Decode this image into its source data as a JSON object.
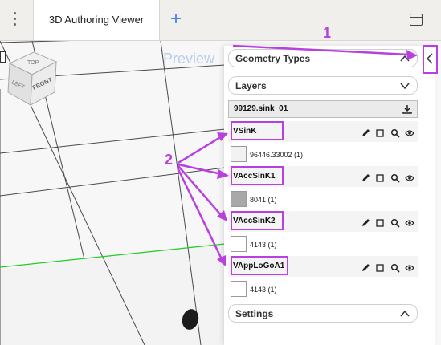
{
  "tabbar": {
    "tab_title": "3D Authoring Viewer",
    "plus": "+"
  },
  "viewport": {
    "preview_label": "Preview",
    "cube": {
      "top": "TOP",
      "left": "LEFT",
      "front": "FRONT"
    }
  },
  "panel": {
    "geometry_types": "Geometry Types",
    "layers": "Layers",
    "file_name": "99129.sink_01",
    "items": [
      {
        "name": "VSinK",
        "material": "96446.33002 (1)",
        "swatch_color": "#f2f2f2"
      },
      {
        "name": "VAccSinK1",
        "material": "8041 (1)",
        "swatch_color": "#a8a8a8"
      },
      {
        "name": "VAccSinK2",
        "material": "4143 (1)",
        "swatch_color": "#ffffff"
      },
      {
        "name": "VAppLoGoA1",
        "material": "4143 (1)",
        "swatch_color": "#ffffff"
      }
    ],
    "settings": "Settings"
  },
  "annotations": {
    "label_1": "1",
    "label_2": "2",
    "color": "#b840e0"
  }
}
